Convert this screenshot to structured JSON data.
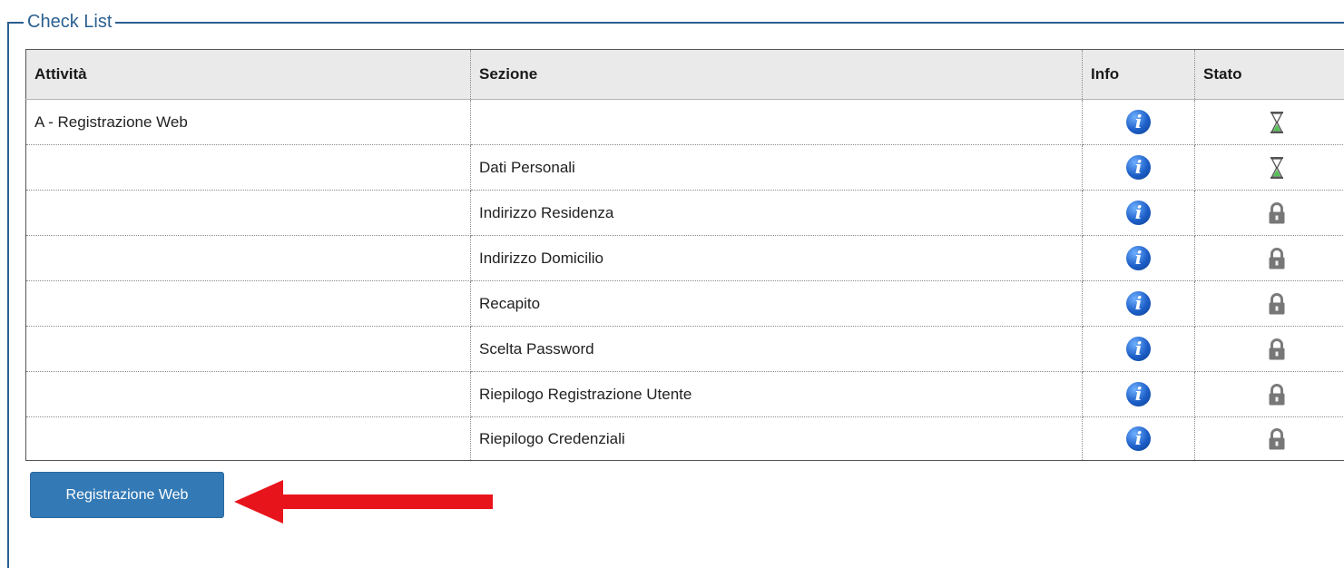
{
  "fieldset": {
    "legend": "Check List"
  },
  "table": {
    "headers": [
      "Attività",
      "Sezione",
      "Info",
      "Stato"
    ],
    "rows": [
      {
        "attivita": "A - Registrazione Web",
        "sezione": "",
        "info": "info-icon",
        "stato": "hourglass-icon"
      },
      {
        "attivita": "",
        "sezione": "Dati Personali",
        "info": "info-icon",
        "stato": "hourglass-icon"
      },
      {
        "attivita": "",
        "sezione": "Indirizzo Residenza",
        "info": "info-icon",
        "stato": "lock-icon"
      },
      {
        "attivita": "",
        "sezione": "Indirizzo Domicilio",
        "info": "info-icon",
        "stato": "lock-icon"
      },
      {
        "attivita": "",
        "sezione": "Recapito",
        "info": "info-icon",
        "stato": "lock-icon"
      },
      {
        "attivita": "",
        "sezione": "Scelta Password",
        "info": "info-icon",
        "stato": "lock-icon"
      },
      {
        "attivita": "",
        "sezione": "Riepilogo Registrazione Utente",
        "info": "info-icon",
        "stato": "lock-icon"
      },
      {
        "attivita": "",
        "sezione": "Riepilogo Credenziali",
        "info": "info-icon",
        "stato": "lock-icon"
      }
    ]
  },
  "action": {
    "button_label": "Registrazione Web"
  },
  "annotation": {
    "arrow_color": "#e8141b"
  },
  "colors": {
    "accent": "#2a5f91",
    "button": "#3379b5",
    "info": "#1d5fc8"
  }
}
